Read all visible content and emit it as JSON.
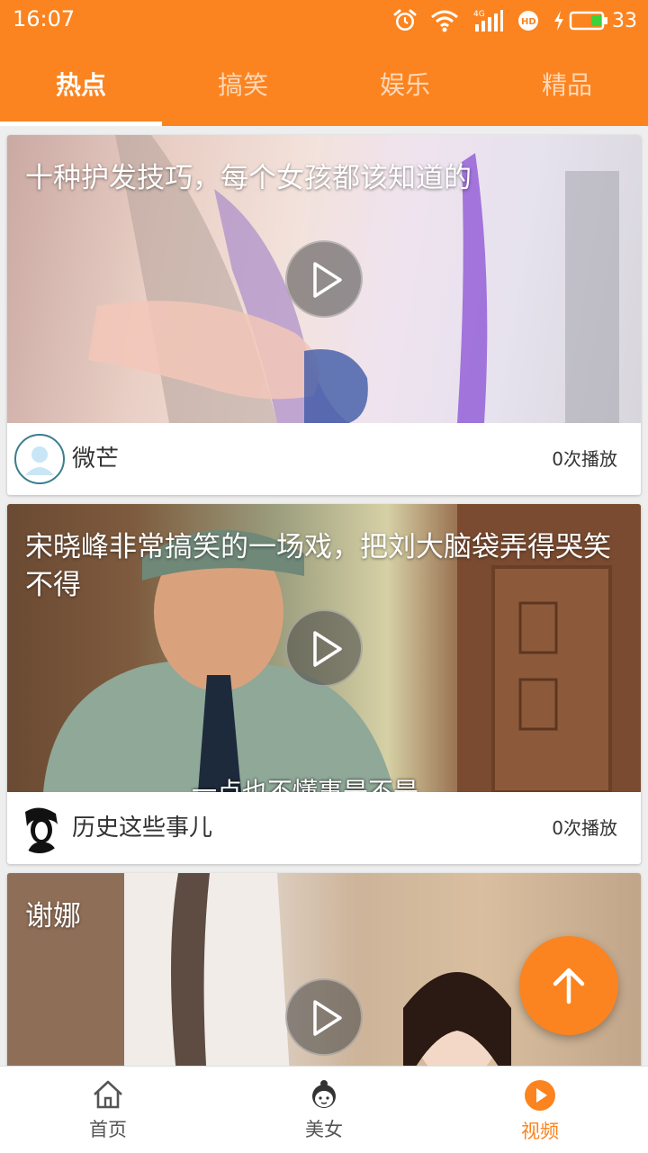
{
  "status_bar": {
    "time": "16:07",
    "battery": "33",
    "network": "4G",
    "icons": [
      "alarm-icon",
      "wifi-icon",
      "signal-icon",
      "hd-icon",
      "charging-icon",
      "battery-icon"
    ]
  },
  "tabs": [
    {
      "label": "热点",
      "active": true
    },
    {
      "label": "搞笑",
      "active": false
    },
    {
      "label": "娱乐",
      "active": false
    },
    {
      "label": "精品",
      "active": false
    }
  ],
  "videos": [
    {
      "title": "十种护发技巧，每个女孩都该知道的",
      "author": "微芒",
      "plays": "0次播放"
    },
    {
      "title": "宋晓峰非常搞笑的一场戏，把刘大脑袋弄得哭笑不得",
      "author": "历史这些事儿",
      "plays": "0次播放",
      "caption": "一点也不懂事是不是"
    },
    {
      "title": "谢娜",
      "author": "",
      "plays": ""
    }
  ],
  "bottom_nav": [
    {
      "label": "首页",
      "icon": "home-icon",
      "active": false
    },
    {
      "label": "美女",
      "icon": "girl-face-icon",
      "active": false
    },
    {
      "label": "视频",
      "icon": "video-play-icon",
      "active": true
    }
  ],
  "colors": {
    "accent": "#fb8420",
    "nav_inactive": "#555555"
  }
}
